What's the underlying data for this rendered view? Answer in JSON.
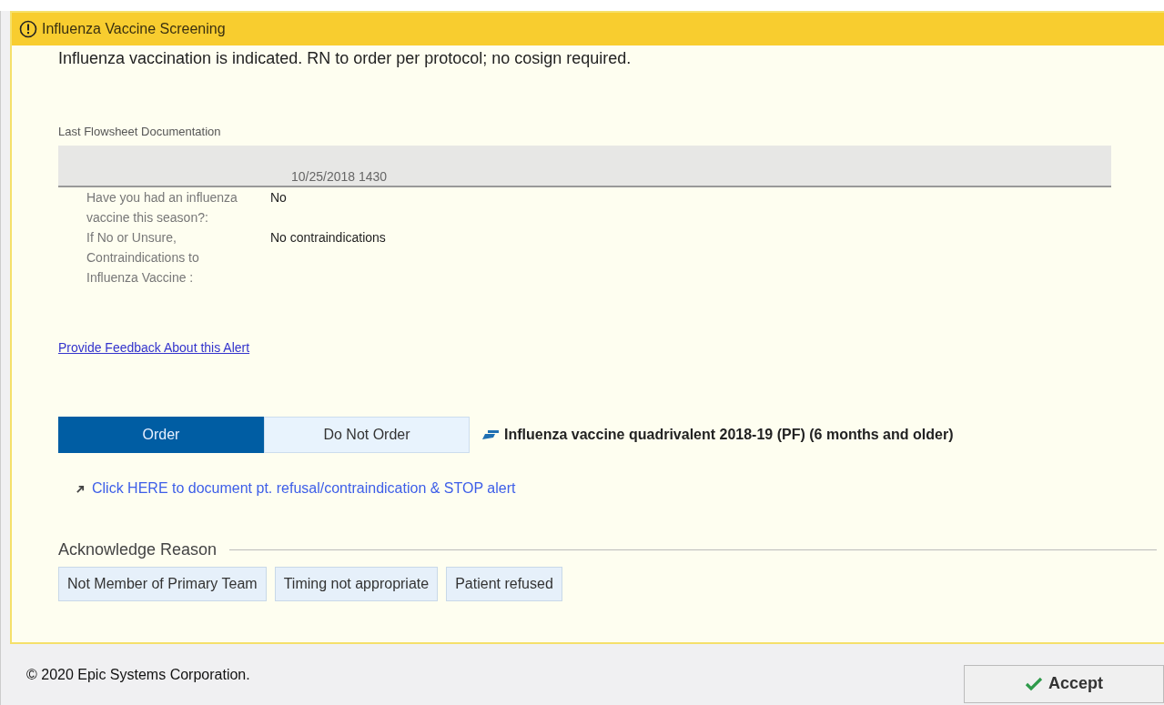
{
  "alert": {
    "title": "Influenza Vaccine Screening",
    "message": "Influenza vaccination is indicated. RN to order per protocol; no cosign required.",
    "flowsheet": {
      "heading": "Last Flowsheet Documentation",
      "column": "10/25/2018 1430",
      "rows": [
        {
          "label": "Have you had an influenza vaccine this season?:",
          "value": "No"
        },
        {
          "label": "If No or Unsure, Contraindications to Influenza Vaccine :",
          "value": "No contraindications"
        }
      ]
    },
    "feedback_link": "Provide Feedback About this Alert",
    "order_options": [
      {
        "label": "Order",
        "selected": true
      },
      {
        "label": "Do Not Order",
        "selected": false
      }
    ],
    "order_name": "Influenza vaccine quadrivalent 2018-19 (PF) (6 months and older)",
    "refusal_link": "Click HERE to document pt. refusal/contraindication & STOP alert",
    "acknowledge": {
      "heading": "Acknowledge Reason",
      "reasons": [
        "Not Member of Primary Team",
        "Timing not appropriate",
        "Patient refused"
      ]
    }
  },
  "footer": {
    "copyright": "© 2020 Epic Systems Corporation.",
    "accept_button": "Accept"
  }
}
